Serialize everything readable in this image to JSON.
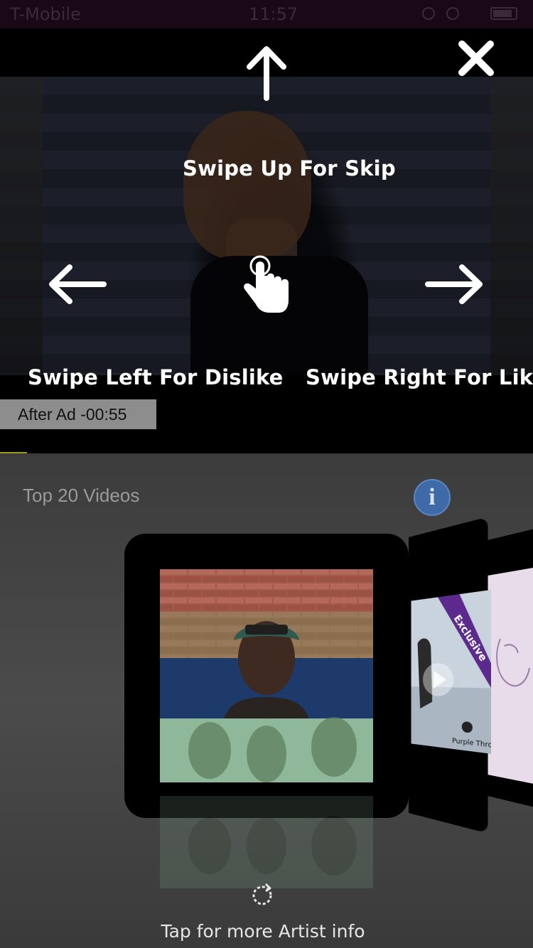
{
  "status_bar": {
    "carrier": "T-Mobile",
    "time": "11:57"
  },
  "overlay": {
    "swipe_up": "Swipe Up For Skip",
    "swipe_left": "Swipe Left For Dislike",
    "swipe_right": "Swipe Right For Like",
    "icons": [
      "arrow-up-icon",
      "arrow-left-icon",
      "arrow-right-icon",
      "tap-hand-icon",
      "close-icon"
    ]
  },
  "ad": {
    "countdown": "After Ad -00:55"
  },
  "gallery": {
    "title": "Top 20 Videos",
    "info_label": "i",
    "side_card_text": [
      "Exclusive",
      "Purple Throne™"
    ],
    "footer": "Tap for more Artist info"
  },
  "colors": {
    "info_button": "#3f6aa8",
    "progress": "#9a9a1a",
    "exclusive_banner": "#5c2a8c"
  }
}
